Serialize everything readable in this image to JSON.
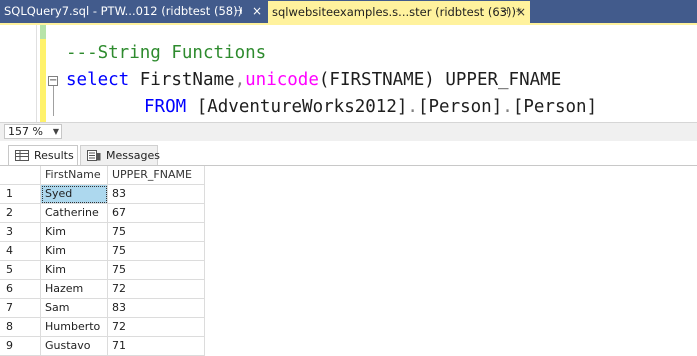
{
  "tabs": [
    {
      "label": "SQLQuery7.sql - PTW...012 (ridbtest (58))",
      "pin": "⊣",
      "close": "×"
    },
    {
      "label": "sqlwebsiteexamples.s...ster (ridbtest (63))*",
      "pin": "⊣",
      "close": "×"
    }
  ],
  "editor": {
    "line1": "---String Functions",
    "line2": {
      "kw1": "select",
      "id1": " FirstName",
      "comma": ",",
      "fn": "unicode",
      "args": "(FIRSTNAME)",
      "id2": " UPPER_FNAME"
    },
    "line3": {
      "kw": "FROM",
      "t1": " [AdventureWorks2012]",
      "d1": ".",
      "t2": "[Person]",
      "d2": ".",
      "t3": "[Person]"
    },
    "fold_symbol": "−"
  },
  "zoom": {
    "value": "157 %",
    "dropdown": "▼"
  },
  "results_tabs": [
    {
      "label": "Results",
      "icon": "grid-icon"
    },
    {
      "label": "Messages",
      "icon": "messages-icon"
    }
  ],
  "grid": {
    "columns": [
      "",
      "FirstName",
      "UPPER_FNAME"
    ],
    "rows": [
      [
        "1",
        "Syed",
        "83"
      ],
      [
        "2",
        "Catherine",
        "67"
      ],
      [
        "3",
        "Kim",
        "75"
      ],
      [
        "4",
        "Kim",
        "75"
      ],
      [
        "5",
        "Kim",
        "75"
      ],
      [
        "6",
        "Hazem",
        "72"
      ],
      [
        "7",
        "Sam",
        "83"
      ],
      [
        "8",
        "Humberto",
        "72"
      ],
      [
        "9",
        "Gustavo",
        "71"
      ]
    ]
  },
  "colors": {
    "tab_active": "#fff29d",
    "tab_inactive": "#425b8c",
    "keyword": "#0000ff",
    "function": "#ff00ff",
    "comment": "#2e8b2e",
    "selection": "#add8ee"
  }
}
